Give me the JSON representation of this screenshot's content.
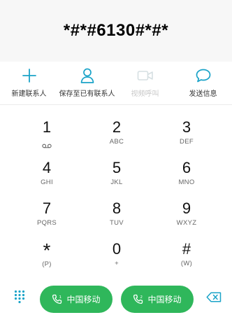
{
  "display": {
    "number": "*#*#6130#*#*"
  },
  "actions": [
    {
      "label": "新建联系人",
      "icon": "plus-icon",
      "enabled": true
    },
    {
      "label": "保存至已有联系人",
      "icon": "person-icon",
      "enabled": true
    },
    {
      "label": "视频呼叫",
      "icon": "video-camera-icon",
      "enabled": false
    },
    {
      "label": "发送信息",
      "icon": "message-bubble-icon",
      "enabled": true
    }
  ],
  "keypad": {
    "k1": {
      "digit": "1",
      "letters": ""
    },
    "k2": {
      "digit": "2",
      "letters": "ABC"
    },
    "k3": {
      "digit": "3",
      "letters": "DEF"
    },
    "k4": {
      "digit": "4",
      "letters": "GHI"
    },
    "k5": {
      "digit": "5",
      "letters": "JKL"
    },
    "k6": {
      "digit": "6",
      "letters": "MNO"
    },
    "k7": {
      "digit": "7",
      "letters": "PQRS"
    },
    "k8": {
      "digit": "8",
      "letters": "TUV"
    },
    "k9": {
      "digit": "9",
      "letters": "WXYZ"
    },
    "star": {
      "digit": "*",
      "letters": "(P)"
    },
    "k0": {
      "digit": "0",
      "letters": "+"
    },
    "hash": {
      "digit": "#",
      "letters": "(W)"
    }
  },
  "bottom": {
    "call_sim1_label": "中国移动",
    "call_sim2_label": "中国移动"
  },
  "colors": {
    "accent": "#1aa3c8",
    "call_green": "#2fb75b",
    "disabled": "#c8c8c8"
  }
}
